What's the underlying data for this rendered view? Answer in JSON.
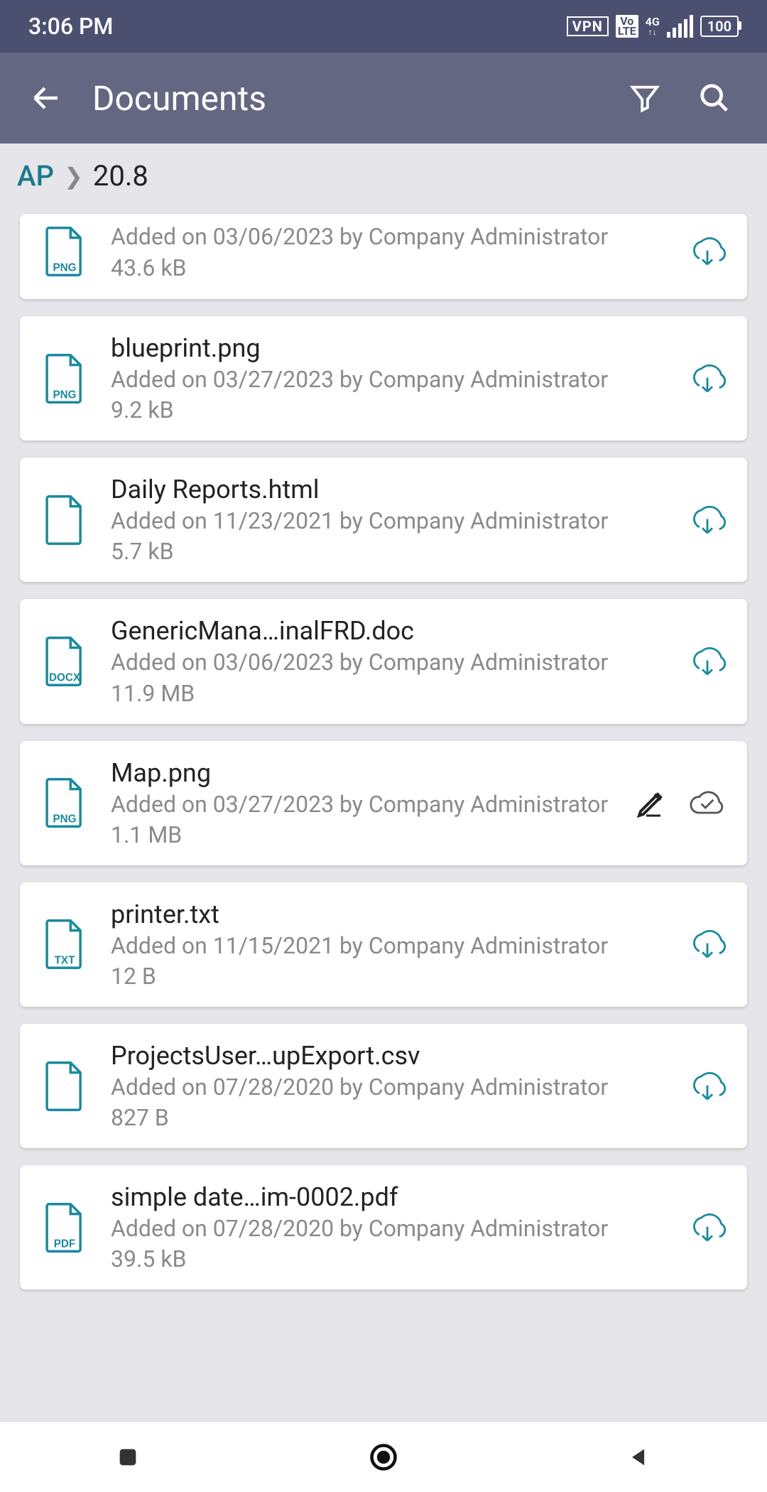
{
  "status": {
    "time": "3:06 PM",
    "vpn": "VPN",
    "lte": "Vo\nLTE",
    "net": "4G",
    "battery": "100"
  },
  "appbar": {
    "title": "Documents"
  },
  "breadcrumb": {
    "parent": "AP",
    "current": "20.8"
  },
  "documents": [
    {
      "name": "",
      "meta": "Added on 03/06/2023 by Company Administrator",
      "size": "43.6 kB",
      "ext": "PNG",
      "actions": [
        "download"
      ]
    },
    {
      "name": "blueprint.png",
      "meta": "Added on 03/27/2023 by Company Administrator",
      "size": "9.2 kB",
      "ext": "PNG",
      "actions": [
        "download"
      ]
    },
    {
      "name": "Daily Reports.html",
      "meta": "Added on 11/23/2021 by Company Administrator",
      "size": "5.7 kB",
      "ext": "",
      "actions": [
        "download"
      ]
    },
    {
      "name": "GenericMana…inalFRD.doc",
      "meta": "Added on 03/06/2023 by Company Administrator",
      "size": "11.9 MB",
      "ext": "DOCX",
      "actions": [
        "download"
      ]
    },
    {
      "name": "Map.png",
      "meta": "Added on 03/27/2023 by Company Administrator",
      "size": "1.1 MB",
      "ext": "PNG",
      "actions": [
        "edit",
        "synced"
      ]
    },
    {
      "name": "printer.txt",
      "meta": "Added on 11/15/2021 by Company Administrator",
      "size": "12 B",
      "ext": "TXT",
      "actions": [
        "download"
      ]
    },
    {
      "name": "ProjectsUser…upExport.csv",
      "meta": "Added on 07/28/2020 by Company Administrator",
      "size": "827 B",
      "ext": "",
      "actions": [
        "download"
      ]
    },
    {
      "name": "simple date…im-0002.pdf",
      "meta": "Added on 07/28/2020 by Company Administrator",
      "size": "39.5 kB",
      "ext": "PDF",
      "actions": [
        "download"
      ]
    }
  ],
  "colors": {
    "teal": "#1a8a9c",
    "grey": "#8a8a8a",
    "dark": "#222"
  }
}
